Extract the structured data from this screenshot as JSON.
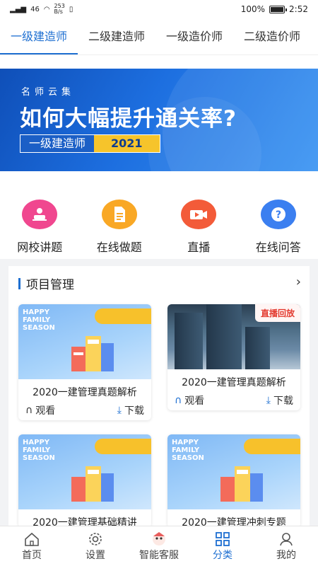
{
  "status": {
    "signal": "46",
    "speed": "253\nB/s",
    "battery": "100%",
    "time": "2:52"
  },
  "tabs": [
    {
      "label": "一级建造师",
      "active": true
    },
    {
      "label": "二级建造师",
      "active": false
    },
    {
      "label": "一级造价师",
      "active": false
    },
    {
      "label": "二级造价师",
      "active": false
    }
  ],
  "banner": {
    "subtitle": "名师云集",
    "headline": "如何大幅提升通关率?",
    "tag": "一级建造师",
    "year": "2021"
  },
  "quick": [
    {
      "label": "网校讲题",
      "icon": "lecture-icon",
      "color": "#f0478f"
    },
    {
      "label": "在线做题",
      "icon": "document-icon",
      "color": "#f9a825"
    },
    {
      "label": "直播",
      "icon": "camera-icon",
      "color": "#f35b39"
    },
    {
      "label": "在线问答",
      "icon": "question-icon",
      "color": "#3b7ff0"
    }
  ],
  "section": {
    "title": "项目管理"
  },
  "cards": [
    {
      "title": "2020一建管理真题解析",
      "watch": "观看",
      "download": "下载",
      "art": "HAPPY FAMILY SEASON"
    },
    {
      "title": "2020一建管理真题解析",
      "watch": "观看",
      "download": "下载",
      "badge": "直播回放"
    },
    {
      "title": "2020一建管理基础精讲",
      "art": "HAPPY FAMILY SEASON"
    },
    {
      "title": "2020一建管理冲刺专题",
      "art": "HAPPY FAMILY SEASON"
    }
  ],
  "nav": [
    {
      "label": "首页",
      "icon": "home-icon",
      "active": false
    },
    {
      "label": "设置",
      "icon": "gear-icon",
      "active": false
    },
    {
      "label": "智能客服",
      "icon": "robot-icon",
      "active": false
    },
    {
      "label": "分类",
      "icon": "category-icon",
      "active": true
    },
    {
      "label": "我的",
      "icon": "user-icon",
      "active": false
    }
  ],
  "colors": {
    "accent": "#1e6fd1",
    "banner_year": "#f6c42b",
    "live_badge": "#e33a2f"
  }
}
